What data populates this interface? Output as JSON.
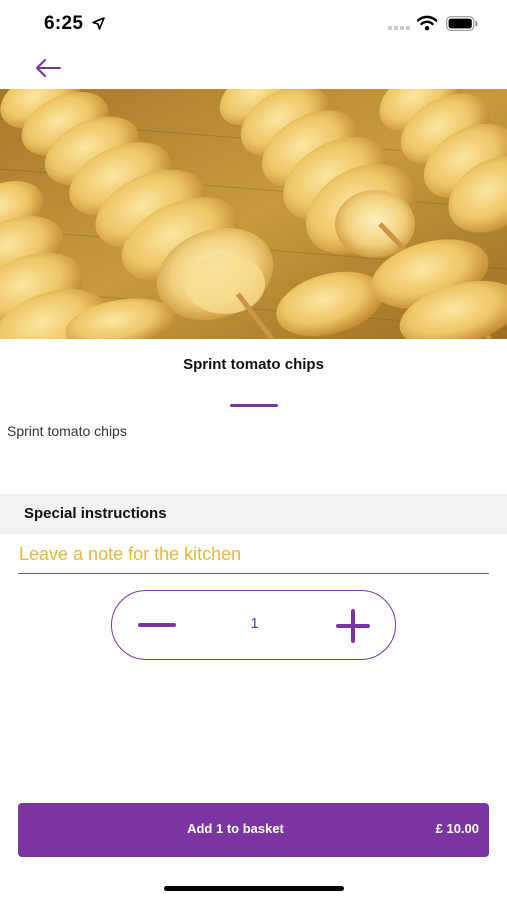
{
  "status_bar": {
    "time": "6:25"
  },
  "nav": {
    "back_icon": "arrow-left-icon"
  },
  "hero": {
    "image": "spiral-potato-chips-photo"
  },
  "product": {
    "title": "Sprint tomato chips",
    "description": "Sprint tomato chips"
  },
  "instructions": {
    "label": "Special instructions",
    "placeholder": "Leave a note for the kitchen",
    "value": ""
  },
  "quantity": {
    "value": "1"
  },
  "basket": {
    "button_label": "Add 1 to basket",
    "price": "£ 10.00"
  },
  "colors": {
    "accent": "#7b35a3",
    "placeholder": "#e6b937",
    "section_bg": "#f2f2f2"
  }
}
